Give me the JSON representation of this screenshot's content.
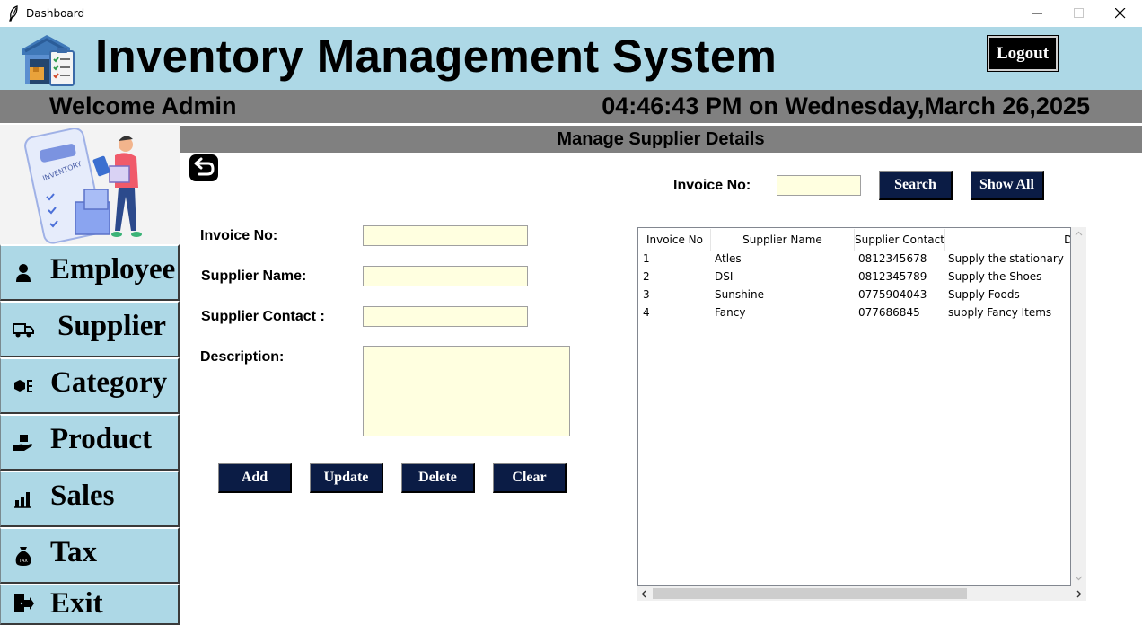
{
  "window": {
    "title": "Dashboard"
  },
  "header": {
    "title": "Inventory Management System",
    "logout_label": "Logout"
  },
  "welcome": {
    "text": "Welcome Admin",
    "datetime": "04:46:43 PM on Wednesday,March 26,2025"
  },
  "sidebar": {
    "items": [
      {
        "label": "Employee",
        "icon": "person-icon"
      },
      {
        "label": "Supplier",
        "icon": "truck-icon"
      },
      {
        "label": "Category",
        "icon": "category-icon"
      },
      {
        "label": "Product",
        "icon": "product-hand-icon"
      },
      {
        "label": "Sales",
        "icon": "bar-chart-icon"
      },
      {
        "label": "Tax",
        "icon": "tax-bag-icon"
      },
      {
        "label": "Exit",
        "icon": "exit-door-icon"
      }
    ]
  },
  "main": {
    "heading": "Manage Supplier Details",
    "form": {
      "invoice_label": "Invoice No:",
      "invoice_value": "",
      "supplier_name_label": "Supplier Name:",
      "supplier_name_value": "",
      "supplier_contact_label": "Supplier Contact :",
      "supplier_contact_value": "",
      "description_label": "Description:",
      "description_value": ""
    },
    "buttons": {
      "add": "Add",
      "update": "Update",
      "delete": "Delete",
      "clear": "Clear"
    },
    "search": {
      "label": "Invoice No:",
      "value": "",
      "search_label": "Search",
      "show_all_label": "Show All"
    },
    "table": {
      "columns": [
        "Invoice No",
        "Supplier Name",
        "Supplier Contact",
        "Des"
      ],
      "rows": [
        [
          "1",
          "Atles",
          "0812345678",
          "Supply the stationary"
        ],
        [
          "2",
          "DSI",
          "0812345789",
          "Supply the Shoes"
        ],
        [
          "3",
          "Sunshine",
          "0775904043",
          "Supply Foods"
        ],
        [
          "4",
          "Fancy",
          "077686845",
          "supply Fancy Items"
        ]
      ]
    }
  },
  "colors": {
    "header_bg": "#add8e6",
    "bar_bg": "#808080",
    "button_bg": "#0b1c45",
    "input_bg": "#ffffe0"
  }
}
